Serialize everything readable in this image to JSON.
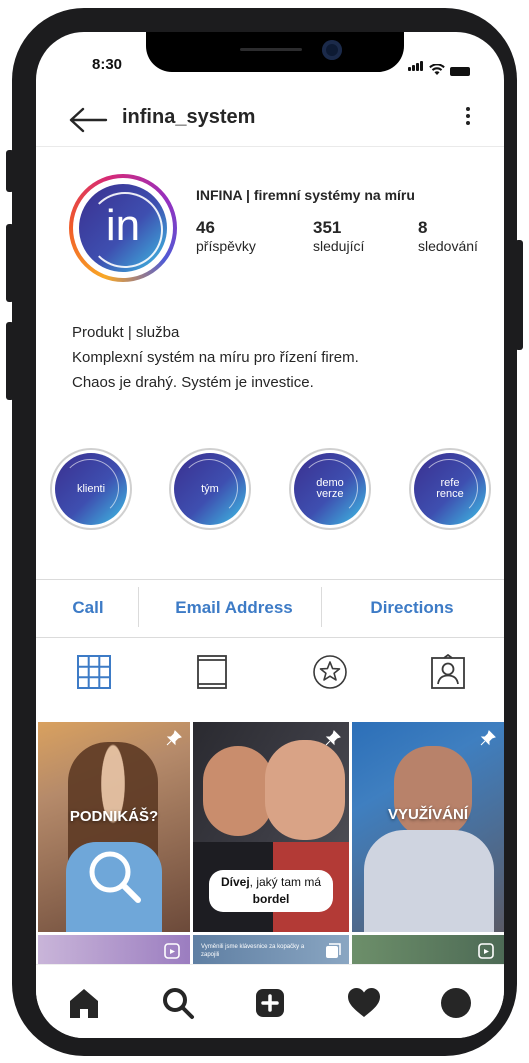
{
  "status_bar": {
    "time": "8:30"
  },
  "header": {
    "username": "infina_system",
    "back_icon": "back-arrow-icon",
    "more_icon": "more-vertical-icon"
  },
  "profile": {
    "avatar_text": "in",
    "display_name": "INFINA | firemní systémy na míru",
    "stats": [
      {
        "value": "46",
        "label": "příspěvky"
      },
      {
        "value": "351",
        "label": "sledující"
      },
      {
        "value": "8",
        "label": "sledování"
      }
    ],
    "bio": [
      "Produkt | služba",
      "Komplexní systém na míru pro řízení firem.",
      "Chaos je drahý. Systém je investice."
    ]
  },
  "highlights": [
    {
      "line1": "klienti",
      "line2": ""
    },
    {
      "line1": "tým",
      "line2": ""
    },
    {
      "line1": "demo",
      "line2": "verze"
    },
    {
      "line1": "refe",
      "line2": "rence"
    }
  ],
  "actions": {
    "call": "Call",
    "email": "Email Address",
    "directions": "Directions"
  },
  "tabs": [
    "grid-icon",
    "reels-icon",
    "star-icon",
    "tagged-icon"
  ],
  "posts": [
    {
      "caption": "PODNIKÁŠ?",
      "pinned": true
    },
    {
      "caption_bold": "Dívej",
      "caption_rest": ", jaký tam má",
      "caption_line2": "bordel",
      "pinned": true
    },
    {
      "caption": "VYUŽÍVÁNÍ",
      "pinned": true
    },
    {
      "caption": "",
      "type": "reel"
    },
    {
      "caption": "Vyměnili jsme klávesnice za kopačky a zapojili",
      "type": "carousel"
    },
    {
      "caption": "",
      "type": "reel"
    }
  ],
  "bottom_nav": [
    "home-icon",
    "search-icon",
    "new-post-icon",
    "activity-heart-icon",
    "profile-icon"
  ],
  "colors": {
    "accent_blue": "#3d7bc6",
    "brand_dark": "#3a2f8f",
    "brand_light": "#3ec3e6"
  }
}
